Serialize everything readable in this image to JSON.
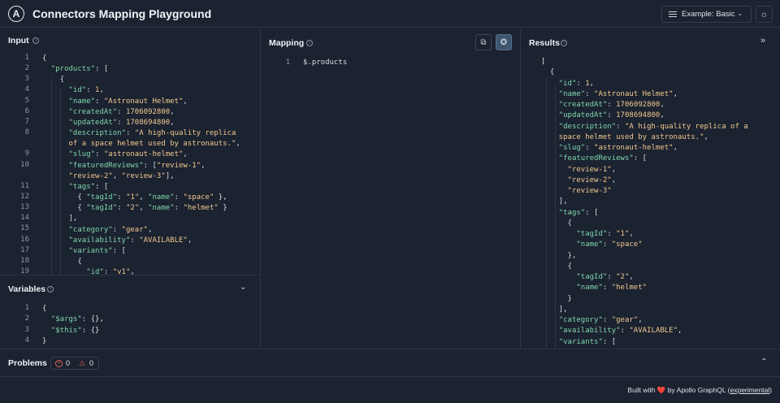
{
  "header": {
    "logo_letter": "A",
    "title": "Connectors Mapping Playground",
    "example_label": "Example:",
    "example_value": "Basic",
    "theme_icon": "sun-icon"
  },
  "input": {
    "title": "Input",
    "line_numbers": [
      "1",
      "2",
      "3",
      "4",
      "5",
      "6",
      "7",
      "8",
      "",
      "9",
      "10",
      "",
      "11",
      "12",
      "13",
      "14",
      "15",
      "16",
      "17",
      "18",
      "19"
    ]
  },
  "variables": {
    "title": "Variables",
    "line_numbers": [
      "1",
      "2",
      "3",
      "4"
    ]
  },
  "mapping": {
    "title": "Mapping",
    "line_numbers": [
      "1"
    ],
    "code": "$.products"
  },
  "results": {
    "title": "Results"
  },
  "problems": {
    "title": "Problems",
    "errors": "0",
    "warnings": "0"
  },
  "footer": {
    "prefix": "Built with",
    "heart": "❤️",
    "by": "by Apollo GraphQL (",
    "link": "experimental",
    "suffix": ")"
  },
  "colors": {
    "background": "#1b2230",
    "key": "#7fd7ad",
    "string": "#f2c98f",
    "border": "#2c3545"
  }
}
